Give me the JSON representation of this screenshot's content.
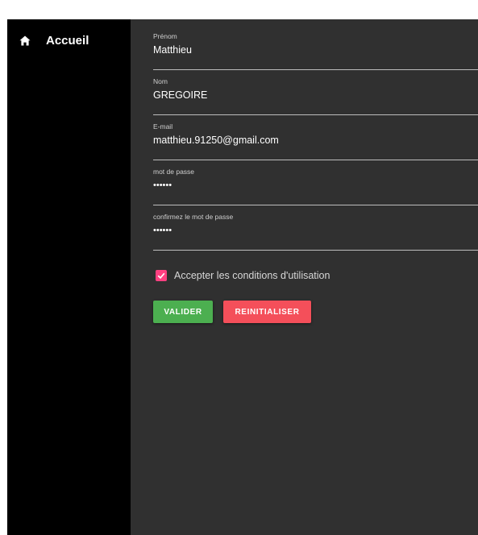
{
  "sidebar": {
    "items": [
      {
        "label": "Accueil",
        "icon": "home-icon"
      }
    ]
  },
  "form": {
    "firstname": {
      "label": "Prénom",
      "value": "Matthieu"
    },
    "lastname": {
      "label": "Nom",
      "value": "GREGOIRE"
    },
    "email": {
      "label": "E-mail",
      "value": "matthieu.91250@gmail.com"
    },
    "password": {
      "label": "mot de passe",
      "value": "••••••"
    },
    "confirm_password": {
      "label": "confirmez le mot de passe",
      "value": "••••••"
    },
    "terms": {
      "label": "Accepter les conditions d'utilisation",
      "checked": true
    },
    "submit_label": "VALIDER",
    "reset_label": "REINITIALISER"
  },
  "colors": {
    "sidebar_bg": "#000000",
    "main_bg": "#303030",
    "checkbox_accent": "#ff4081",
    "submit_bg": "#4caf50",
    "reset_bg": "#f44f5a"
  }
}
